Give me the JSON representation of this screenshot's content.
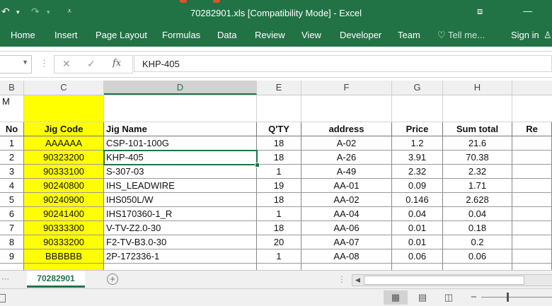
{
  "window": {
    "title": "70282901.xls  [Compatibility Mode] - Excel"
  },
  "ribbon": {
    "tabs": [
      "Home",
      "Insert",
      "Page Layout",
      "Formulas",
      "Data",
      "Review",
      "View",
      "Developer",
      "Team"
    ],
    "tell_me": "Tell me...",
    "sign_in": "Sign in"
  },
  "formula_bar": {
    "name_box": "",
    "content": "KHP-405"
  },
  "columns": [
    "B",
    "C",
    "D",
    "E",
    "F",
    "G",
    "H"
  ],
  "sheet": {
    "top_row_text": "M",
    "headers": [
      "No",
      "Jig Code",
      "Jig Name",
      "Q'TY",
      "address",
      "Price",
      "Sum total",
      "Re"
    ],
    "rows": [
      [
        "1",
        "AAAAAA",
        "CSP-101-100G",
        "18",
        "A-02",
        "1.2",
        "21.6"
      ],
      [
        "2",
        "90323200",
        "KHP-405",
        "18",
        "A-26",
        "3.91",
        "70.38"
      ],
      [
        "3",
        "90333100",
        "S-307-03",
        "1",
        "A-49",
        "2.32",
        "2.32"
      ],
      [
        "4",
        "90240800",
        "IHS_LEADWIRE",
        "19",
        "AA-01",
        "0.09",
        "1.71"
      ],
      [
        "5",
        "90240900",
        "IHS050L/W",
        "18",
        "AA-02",
        "0.146",
        "2.628"
      ],
      [
        "6",
        "90241400",
        "IHS170360-1_R",
        "1",
        "AA-04",
        "0.04",
        "0.04"
      ],
      [
        "7",
        "90333300",
        "V-TV-Z2.0-30",
        "18",
        "AA-06",
        "0.01",
        "0.18"
      ],
      [
        "8",
        "90333200",
        "F2-TV-B3.0-30",
        "20",
        "AA-07",
        "0.01",
        "0.2"
      ],
      [
        "9",
        "BBBBBB",
        "2P-172336-1",
        "1",
        "AA-08",
        "0.06",
        "0.06"
      ]
    ]
  },
  "sheet_tabs": [
    "70282901"
  ],
  "colors": {
    "accent": "#217346",
    "highlight": "#ffff00"
  }
}
